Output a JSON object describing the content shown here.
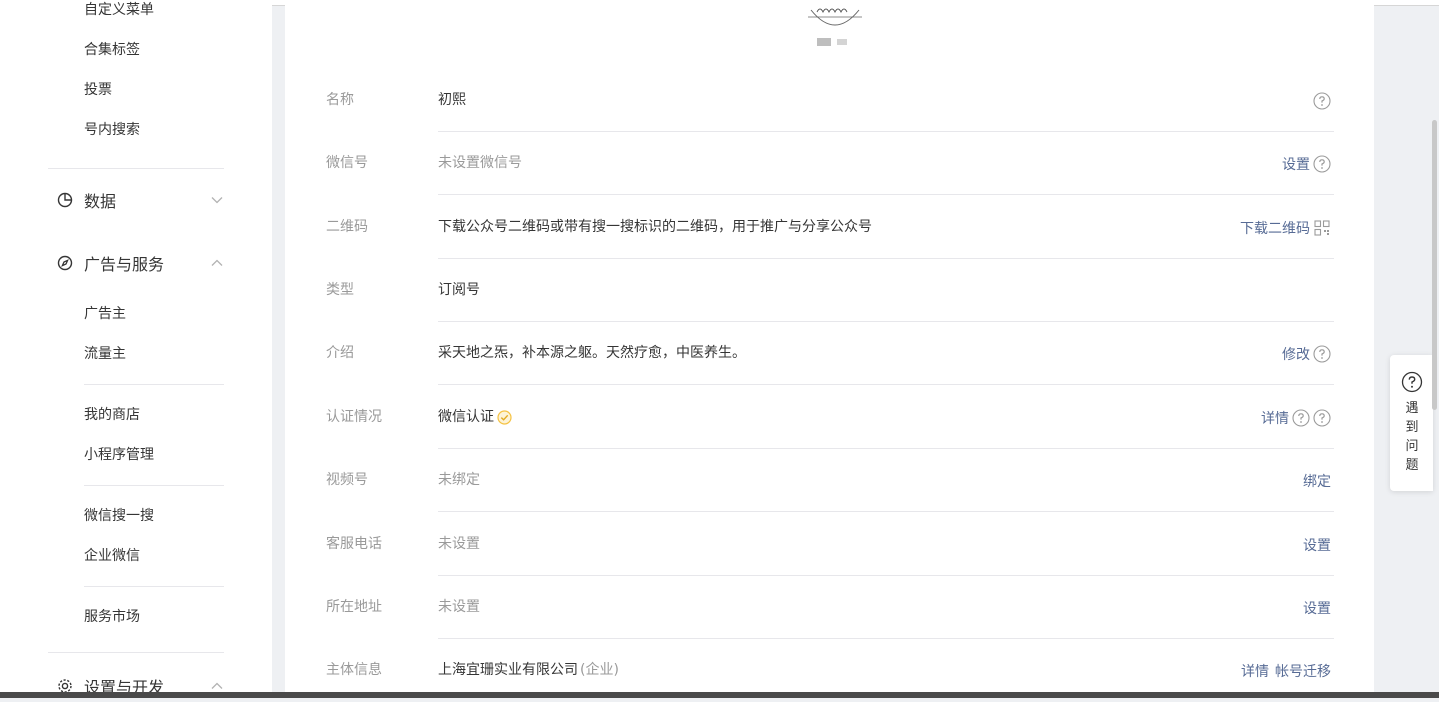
{
  "sidebar": {
    "top_items": [
      "自定义菜单",
      "合集标签",
      "投票",
      "号内搜索"
    ],
    "data_group": "数据",
    "ads_group": "广告与服务",
    "ads_items_a": [
      "广告主",
      "流量主"
    ],
    "ads_items_b": [
      "我的商店",
      "小程序管理"
    ],
    "ads_items_c": [
      "微信搜一搜",
      "企业微信"
    ],
    "ads_items_d": [
      "服务市场"
    ],
    "settings_group": "设置与开发"
  },
  "account": {
    "rows": [
      {
        "label": "名称",
        "value": "初熙",
        "actions": []
      },
      {
        "label": "微信号",
        "value": "未设置微信号",
        "actions": [
          "设置"
        ]
      },
      {
        "label": "二维码",
        "value": "下载公众号二维码或带有搜一搜标识的二维码，用于推广与分享公众号",
        "actions": [
          "下载二维码"
        ]
      },
      {
        "label": "类型",
        "value": "订阅号",
        "actions": []
      },
      {
        "label": "介绍",
        "value": "采天地之炁，补本源之躯。天然疗愈，中医养生。",
        "actions": [
          "修改"
        ]
      },
      {
        "label": "认证情况",
        "value": "微信认证",
        "actions": [
          "详情"
        ]
      },
      {
        "label": "视频号",
        "value": "未绑定",
        "actions": [
          "绑定"
        ]
      },
      {
        "label": "客服电话",
        "value": "未设置",
        "actions": [
          "设置"
        ]
      },
      {
        "label": "所在地址",
        "value": "未设置",
        "actions": [
          "设置"
        ]
      },
      {
        "label": "主体信息",
        "value": "上海宜珊实业有限公司",
        "value_suffix": "(企业)",
        "actions": [
          "详情",
          "帐号迁移"
        ]
      }
    ]
  },
  "help_widget": {
    "label": "遇到问题"
  },
  "colors": {
    "link": "#576b95",
    "muted": "#9a9a9a",
    "verified": "#f5c242"
  }
}
